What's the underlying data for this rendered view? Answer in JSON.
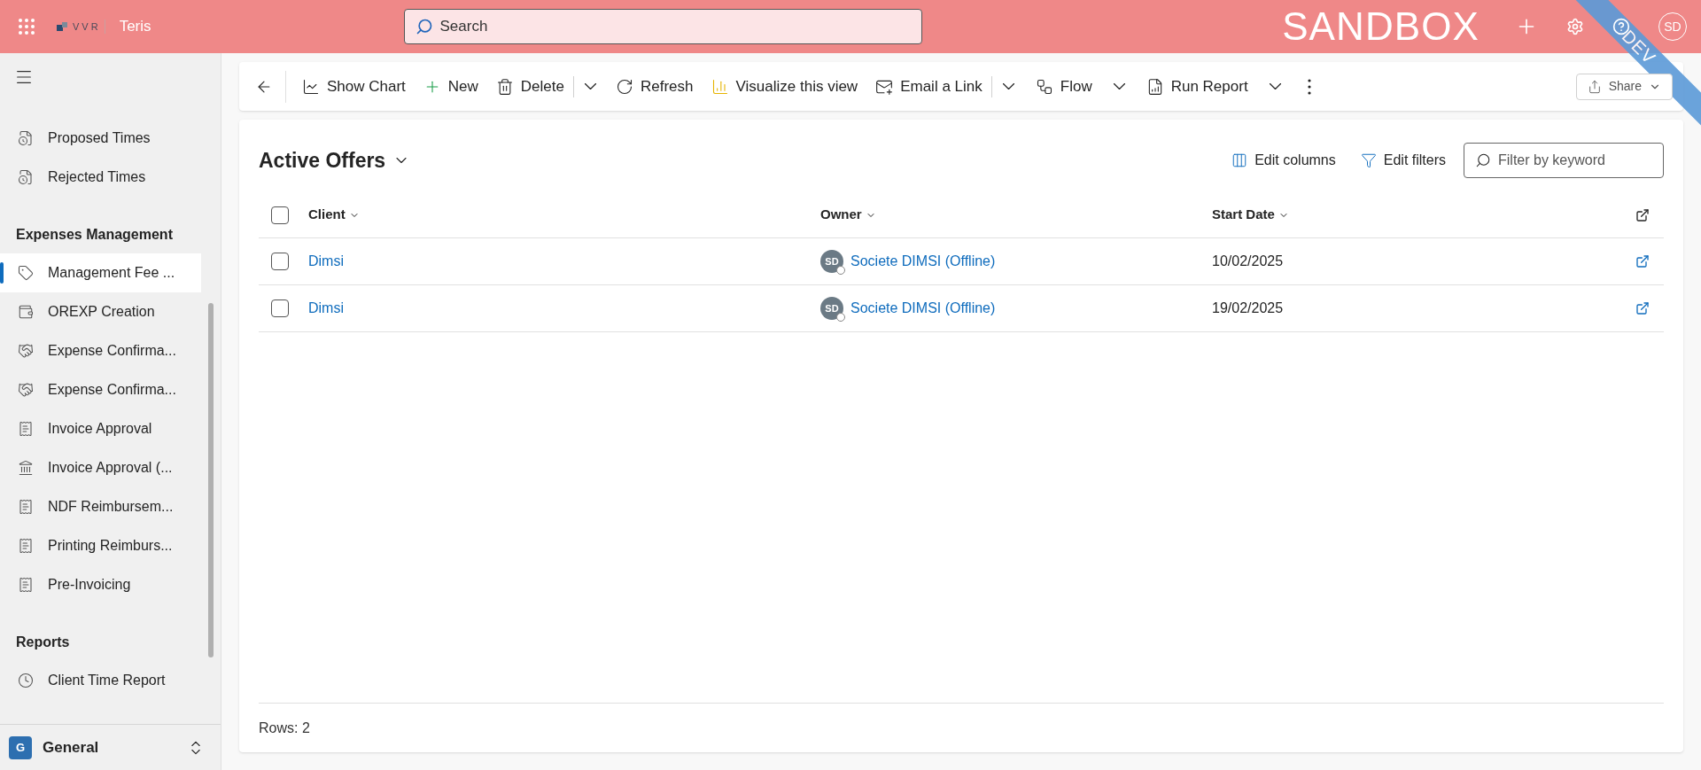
{
  "top_bar": {
    "logo_text": "VVR",
    "app_name": "Teris",
    "search_placeholder": "Search",
    "environment": "SANDBOX",
    "avatar": "SD",
    "ribbon": "DEV"
  },
  "sidebar": {
    "groups": [
      {
        "items": [
          {
            "label": "Proposed Times",
            "selected": false
          },
          {
            "label": "Rejected Times",
            "selected": false
          }
        ]
      },
      {
        "title": "Expenses Management",
        "items": [
          {
            "label": "Management Fee ...",
            "selected": true
          },
          {
            "label": "OREXP Creation",
            "selected": false
          },
          {
            "label": "Expense Confirma...",
            "selected": false
          },
          {
            "label": "Expense Confirma...",
            "selected": false
          },
          {
            "label": "Invoice Approval",
            "selected": false
          },
          {
            "label": "Invoice Approval (...",
            "selected": false
          },
          {
            "label": "NDF Reimbursem...",
            "selected": false
          },
          {
            "label": "Printing Reimburs...",
            "selected": false
          },
          {
            "label": "Pre-Invoicing",
            "selected": false
          }
        ]
      },
      {
        "title": "Reports",
        "items": [
          {
            "label": "Client Time Report",
            "selected": false
          }
        ]
      }
    ],
    "area": {
      "badge": "G",
      "label": "General"
    }
  },
  "toolbar": {
    "items": [
      {
        "kind": "button",
        "label": "Show Chart"
      },
      {
        "kind": "button",
        "label": "New"
      },
      {
        "kind": "button",
        "label": "Delete"
      },
      {
        "kind": "more"
      },
      {
        "kind": "button",
        "label": "Refresh"
      },
      {
        "kind": "button",
        "label": "Visualize this view"
      },
      {
        "kind": "button",
        "label": "Email a Link"
      },
      {
        "kind": "more"
      },
      {
        "kind": "split",
        "label": "Flow"
      },
      {
        "kind": "split",
        "label": "Run Report"
      }
    ],
    "share": "Share"
  },
  "view": {
    "title": "Active Offers",
    "actions": [
      "Edit columns",
      "Edit filters"
    ],
    "filter_placeholder": "Filter by keyword",
    "all_checked": false,
    "columns": [
      "Client",
      "Owner",
      "Start Date"
    ],
    "rows": [
      {
        "client": "Dimsi",
        "owner_initials": "SD",
        "owner": "Societe DIMSI (Offline)",
        "start_date": "10/02/2025",
        "checked": false
      },
      {
        "client": "Dimsi",
        "owner_initials": "SD",
        "owner": "Societe DIMSI (Offline)",
        "start_date": "19/02/2025",
        "checked": false
      }
    ],
    "footer": "Rows: 2"
  }
}
